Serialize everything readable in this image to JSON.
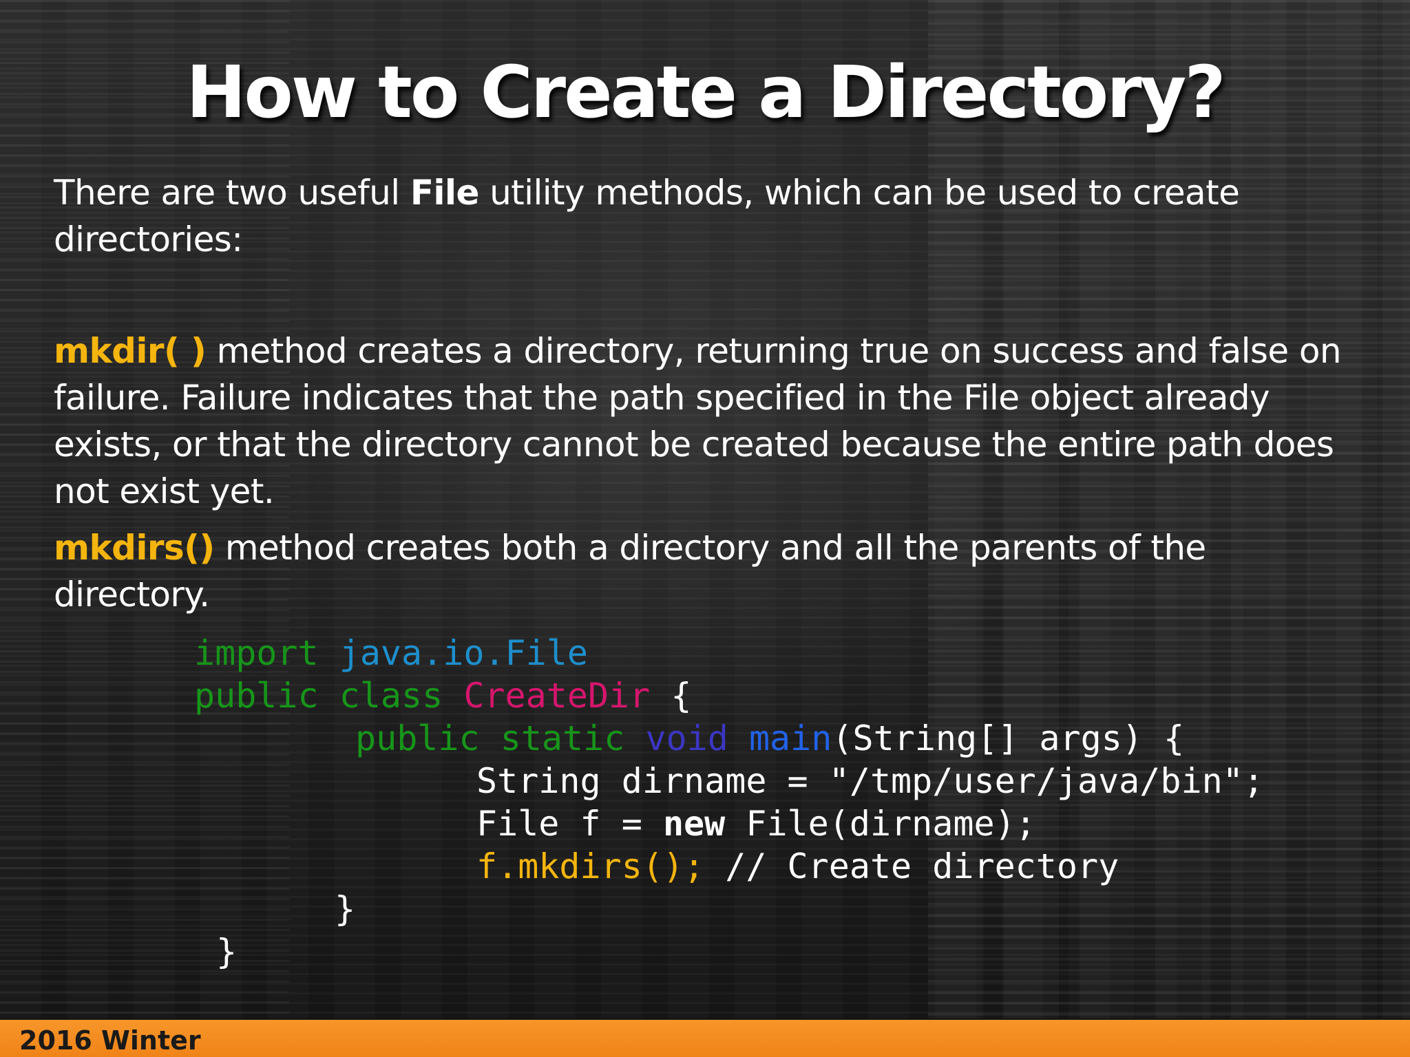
{
  "title": "How to Create a Directory?",
  "intro": {
    "text_before": "There are two useful ",
    "bold_word": "File",
    "text_after_line1": " utility methods, which can be used to create",
    "line2": "directories:"
  },
  "mkdir": {
    "name": "mkdir( )",
    "line1_rest": " method creates a directory, returning true on success and false on",
    "line2": "failure. Failure indicates that the path specified in the File object already",
    "line3": "exists, or that the directory cannot be created because the entire path does",
    "line4": "not exist yet."
  },
  "mkdirs": {
    "name": "mkdirs()",
    "line1_rest": " method creates both a directory and all the parents of the",
    "line2": "directory."
  },
  "code": {
    "l1_import": "import ",
    "l1_pkg": "java.io.File",
    "l2_public": "public ",
    "l2_class": "class ",
    "l2_name": "CreateDir",
    "l2_brace": " {",
    "l3_public": "public ",
    "l3_static": "static ",
    "l3_void": "void ",
    "l3_main": "main",
    "l3_rest": "(String[] args) {",
    "l4": "String dirname = \"/tmp/user/java/bin\";",
    "l5_a": "File f = ",
    "l5_new": "new",
    "l5_b": " File(dirname);",
    "l6_call": "f.mkdirs(); ",
    "l6_comment": "// Create directory",
    "l7": "}",
    "l8": "}"
  },
  "footer": {
    "label": "2016 Winter"
  },
  "colors": {
    "accent_yellow": "#f5b50f",
    "footer_orange": "#f08318",
    "keyword_green": "#17951a",
    "package_blue": "#1e8fcc",
    "class_pink": "#d6166d",
    "void_navy": "#3b36c0",
    "main_blue": "#2262e8"
  }
}
